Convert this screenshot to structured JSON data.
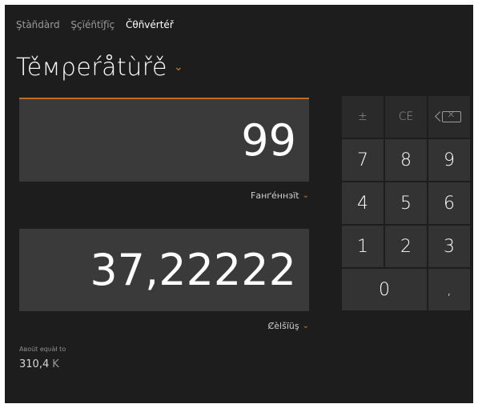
{
  "modes": {
    "standard": "Ştàñdàrd",
    "scientific": "Şçïéñtïƒïç",
    "converter": "Čθñvértéř"
  },
  "header": {
    "title": "Těмρеŕåtùřě"
  },
  "from": {
    "value": "99",
    "unit": "Fанґéннэït"
  },
  "to": {
    "value": "37,22222",
    "unit": "Ȼèlšïüş"
  },
  "about": {
    "label": "Aвοüt еqυàł tο",
    "value": "310,4",
    "unit": "K"
  },
  "keypad": {
    "plus_minus": "±",
    "ce": "CE",
    "backspace_icon": "backspace-icon",
    "digits": [
      "7",
      "8",
      "9",
      "4",
      "5",
      "6",
      "1",
      "2",
      "3"
    ],
    "zero": "0",
    "decimal": ","
  },
  "colors": {
    "accent": "#d07a2b",
    "background": "#1d1d1d",
    "display": "#3a3a3a",
    "key": "#333333"
  }
}
